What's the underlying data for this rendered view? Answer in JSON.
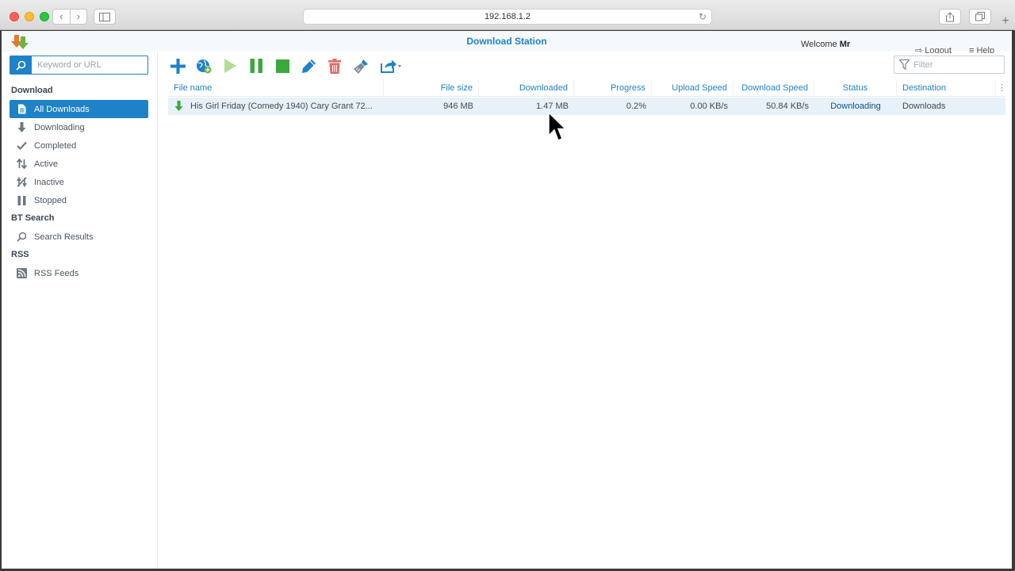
{
  "browser": {
    "url": "192.168.1.2",
    "back_icon": "chevron-left-icon",
    "forward_icon": "chevron-right-icon"
  },
  "app": {
    "title": "Download Station",
    "welcome_prefix": "Welcome",
    "user": "Mr",
    "logout": "Logout",
    "help": "Help",
    "accent_color": "#1e82c8"
  },
  "search": {
    "placeholder": "Keyword or URL"
  },
  "filter": {
    "placeholder": "Filter"
  },
  "sidebar": {
    "download_title": "Download",
    "items": [
      {
        "label": "All Downloads",
        "icon": "document-icon",
        "selected": true
      },
      {
        "label": "Downloading",
        "icon": "arrow-down-icon"
      },
      {
        "label": "Completed",
        "icon": "check-icon"
      },
      {
        "label": "Active",
        "icon": "transfer-arrows-icon"
      },
      {
        "label": "Inactive",
        "icon": "inactive-icon"
      },
      {
        "label": "Stopped",
        "icon": "pause-icon"
      }
    ],
    "bt_title": "BT Search",
    "bt_items": [
      {
        "label": "Search Results",
        "icon": "search-icon"
      }
    ],
    "rss_title": "RSS",
    "rss_items": [
      {
        "label": "RSS Feeds",
        "icon": "rss-icon"
      }
    ]
  },
  "toolbar": {
    "buttons": [
      "add-icon",
      "globe-add-icon",
      "play-icon",
      "pause-icon",
      "stop-icon",
      "edit-icon",
      "trash-icon",
      "clean-brush-icon",
      "share-icon"
    ]
  },
  "table": {
    "columns": [
      "File name",
      "File size",
      "Downloaded",
      "Progress",
      "Upload Speed",
      "Download Speed",
      "Status",
      "Destination"
    ],
    "rows": [
      {
        "file_name": "His Girl Friday (Comedy 1940) Cary Grant 72...",
        "file_size": "946 MB",
        "downloaded": "1.47 MB",
        "progress": "0.2%",
        "upload_speed": "0.00 KB/s",
        "download_speed": "50.84 KB/s",
        "status": "Downloading",
        "destination": "Downloads"
      }
    ]
  }
}
